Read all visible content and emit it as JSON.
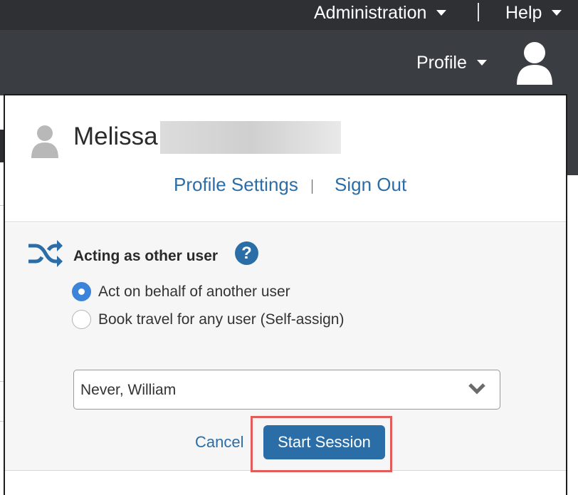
{
  "header": {
    "administration_label": "Administration",
    "help_label": "Help",
    "profile_label": "Profile",
    "avatar_icon": "user-avatar-icon"
  },
  "profile_panel": {
    "user_first_name": "Melissa",
    "profile_settings_label": "Profile Settings",
    "separator": "|",
    "sign_out_label": "Sign Out"
  },
  "acting_as": {
    "icon": "shuffle-icon",
    "title": "Acting as other user",
    "help_symbol": "?",
    "options": [
      {
        "label": "Act on behalf of another user",
        "selected": true
      },
      {
        "label": "Book travel for any user (Self-assign)",
        "selected": false
      }
    ],
    "selected_user": "Never, William",
    "cancel_label": "Cancel",
    "start_label": "Start Session"
  },
  "colors": {
    "header_dark": "#2e3034",
    "header": "#3a3d41",
    "link": "#2b6ea7",
    "primary_button": "#2b6ea7",
    "radio_selected": "#3b84d9",
    "highlight": "#e35b5b"
  }
}
